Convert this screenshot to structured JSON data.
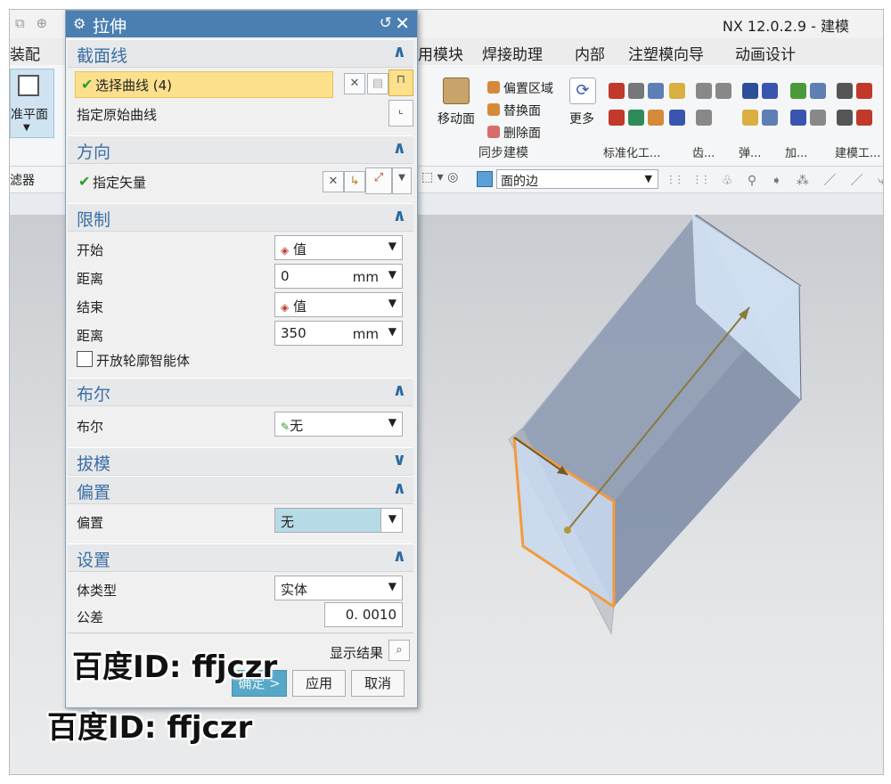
{
  "app": {
    "title": "NX 12.0.2.9 - 建模"
  },
  "menu": [
    "装配",
    "用模块",
    "焊接助理",
    "内部",
    "注塑模向导",
    "动画设计"
  ],
  "ribbon": {
    "datum_plane": "准平面",
    "move_face": "移动面",
    "offset_region": "偏置区域",
    "replace_face": "替换面",
    "delete_face": "删除面",
    "more": "更多",
    "sync_label": "同步建模",
    "groups": [
      "标准化工...",
      "齿...",
      "弹...",
      "加...",
      "建模工..."
    ]
  },
  "toolbar2": {
    "filter_suffix": "滤器",
    "face_edge": "面的边"
  },
  "dialog": {
    "title": "拉伸",
    "section_curve": {
      "title": "截面线",
      "select_curve": "选择曲线 (4)",
      "specify_original": "指定原始曲线"
    },
    "direction": {
      "title": "方向",
      "specify_vector": "指定矢量"
    },
    "limits": {
      "title": "限制",
      "start_label": "开始",
      "start_value": "值",
      "distance1_label": "距离",
      "distance1_value": "0",
      "end_label": "结束",
      "end_value": "值",
      "distance2_label": "距离",
      "distance2_value": "350",
      "unit": "mm",
      "open_profile": "开放轮廓智能体"
    },
    "boolean": {
      "title": "布尔",
      "label": "布尔",
      "value": "无"
    },
    "draft": {
      "title": "拔模"
    },
    "offset": {
      "title": "偏置",
      "label": "偏置",
      "value": "无"
    },
    "settings": {
      "title": "设置",
      "body_type_label": "体类型",
      "body_type_value": "实体",
      "tolerance_label": "公差",
      "tolerance_value": "0. 0010"
    },
    "show_result": "显示结果",
    "ok_button": "确定 >",
    "apply_button": "应用",
    "cancel_button": "取消"
  },
  "watermark": "百度ID: ffjczr"
}
